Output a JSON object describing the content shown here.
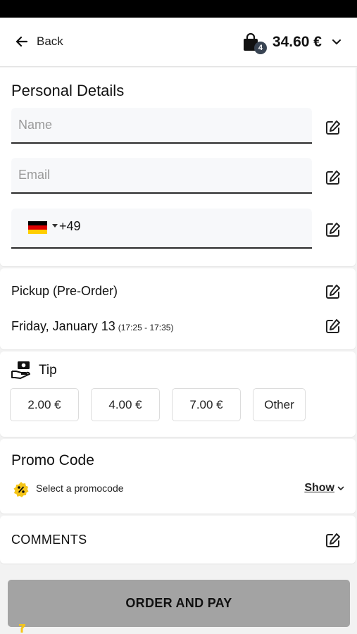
{
  "header": {
    "back_label": "Back",
    "cart_count": "4",
    "cart_total": "34.60 €"
  },
  "personal_details": {
    "title": "Personal Details",
    "name_placeholder": "Name",
    "email_placeholder": "Email",
    "phone_code": "+49",
    "country_flag": "germany-flag-icon"
  },
  "pickup": {
    "label": "Pickup (Pre-Order)",
    "date": "Friday, January 13",
    "time_range": "(17:25 - 17:35)"
  },
  "tip": {
    "title": "Tip",
    "options": [
      "2.00 €",
      "4.00 €",
      "7.00 €",
      "Other"
    ]
  },
  "promo": {
    "title": "Promo Code",
    "select_label": "Select a promocode",
    "show_label": "Show"
  },
  "comments": {
    "title": "COMMENTS"
  },
  "order_button": {
    "label": "ORDER AND PAY"
  },
  "colors": {
    "accent_yellow": "#f5c518",
    "button_disabled": "#a3a3a3",
    "badge": "#394453"
  }
}
